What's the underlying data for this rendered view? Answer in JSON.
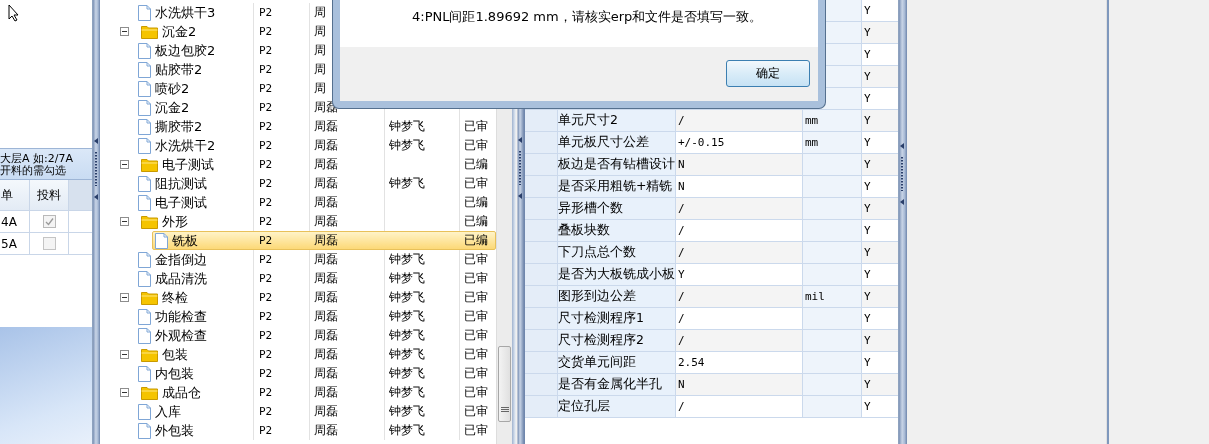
{
  "left_panel": {
    "note_lines": [
      "大层A 如:2/7A",
      "开料的需勾选"
    ],
    "columns": [
      "单",
      "投料"
    ],
    "rows": [
      {
        "order": "4A",
        "checked": true
      },
      {
        "order": "5A",
        "checked": false
      }
    ]
  },
  "tree_grid": {
    "rows": [
      {
        "children": [
          {
            "kind": "file",
            "label": "水洗烘干3",
            "version": "P2",
            "maker": "周",
            "selected": false
          }
        ]
      },
      {
        "kind": "folder",
        "label": "沉金2",
        "expanded": true,
        "version": "P2",
        "maker": "周",
        "selected": false,
        "children": [
          {
            "kind": "file",
            "label": "板边包胶2",
            "version": "P2",
            "maker": "周",
            "selected": false
          },
          {
            "kind": "file",
            "label": "贴胶带2",
            "version": "P2",
            "maker": "周",
            "selected": false
          },
          {
            "kind": "file",
            "label": "喷砂2",
            "version": "P2",
            "maker": "周",
            "selected": false
          },
          {
            "kind": "file",
            "label": "沉金2",
            "version": "P2",
            "maker": "周磊",
            "selected": false
          },
          {
            "kind": "file",
            "label": "撕胶带2",
            "version": "P2",
            "maker": "周磊",
            "checker": "钟梦飞",
            "status": "已审",
            "selected": false
          },
          {
            "kind": "file",
            "label": "水洗烘干2",
            "version": "P2",
            "maker": "周磊",
            "checker": "钟梦飞",
            "status": "已审",
            "selected": false
          }
        ]
      },
      {
        "kind": "folder",
        "label": "电子测试",
        "expanded": true,
        "version": "P2",
        "maker": "周磊",
        "status": "已编",
        "selected": false,
        "children": [
          {
            "kind": "file",
            "label": "阻抗测试",
            "version": "P2",
            "maker": "周磊",
            "checker": "钟梦飞",
            "status": "已审",
            "selected": false
          },
          {
            "kind": "file",
            "label": "电子测试",
            "version": "P2",
            "maker": "周磊",
            "status": "已编",
            "selected": false
          }
        ]
      },
      {
        "kind": "folder",
        "label": "外形",
        "expanded": true,
        "version": "P2",
        "maker": "周磊",
        "status": "已编",
        "selected": false,
        "children": [
          {
            "kind": "file",
            "label": "铣板",
            "version": "P2",
            "maker": "周磊",
            "status": "已编",
            "selected": true
          },
          {
            "kind": "file",
            "label": "金指倒边",
            "version": "P2",
            "maker": "周磊",
            "checker": "钟梦飞",
            "status": "已审",
            "selected": false
          },
          {
            "kind": "file",
            "label": "成品清洗",
            "version": "P2",
            "maker": "周磊",
            "checker": "钟梦飞",
            "status": "已审",
            "selected": false
          }
        ]
      },
      {
        "kind": "folder",
        "label": "终检",
        "expanded": true,
        "version": "P2",
        "maker": "周磊",
        "checker": "钟梦飞",
        "status": "已审",
        "selected": false,
        "children": [
          {
            "kind": "file",
            "label": "功能检查",
            "version": "P2",
            "maker": "周磊",
            "checker": "钟梦飞",
            "status": "已审",
            "selected": false
          },
          {
            "kind": "file",
            "label": "外观检查",
            "version": "P2",
            "maker": "周磊",
            "checker": "钟梦飞",
            "status": "已审",
            "selected": false
          }
        ]
      },
      {
        "kind": "folder",
        "label": "包装",
        "expanded": true,
        "version": "P2",
        "maker": "周磊",
        "checker": "钟梦飞",
        "status": "已审",
        "selected": false,
        "children": [
          {
            "kind": "file",
            "label": "内包装",
            "version": "P2",
            "maker": "周磊",
            "checker": "钟梦飞",
            "status": "已审",
            "selected": false
          }
        ]
      },
      {
        "kind": "folder",
        "label": "成品仓",
        "expanded": true,
        "version": "P2",
        "maker": "周磊",
        "checker": "钟梦飞",
        "status": "已审",
        "selected": false,
        "children": [
          {
            "kind": "file",
            "label": "入库",
            "version": "P2",
            "maker": "周磊",
            "checker": "钟梦飞",
            "status": "已审",
            "selected": false
          },
          {
            "kind": "file",
            "label": "外包装",
            "version": "P2",
            "maker": "周磊",
            "checker": "钟梦飞",
            "status": "已审",
            "selected": false
          }
        ]
      }
    ]
  },
  "param_grid": {
    "rows": [
      {
        "check": "Y"
      },
      {
        "check": "Y"
      },
      {
        "check": "Y"
      },
      {
        "check": "Y"
      },
      {
        "check": "Y"
      },
      {
        "name": "单元尺寸2",
        "value": "/",
        "unit": "mm",
        "check": "Y"
      },
      {
        "name": "单元板尺寸公差",
        "value": "+/-0.15",
        "unit": "mm",
        "check": "Y"
      },
      {
        "name": "板边是否有钻槽设计",
        "value": "N",
        "check": "Y"
      },
      {
        "name": "是否采用粗铣+精铣",
        "value": "N",
        "check": "Y"
      },
      {
        "name": "异形槽个数",
        "value": "/",
        "check": "Y"
      },
      {
        "name": "叠板块数",
        "value": "/",
        "check": "Y"
      },
      {
        "name": "下刀点总个数",
        "value": "/",
        "check": "Y"
      },
      {
        "name": "是否为大板铣成小板",
        "value": "Y",
        "check": "Y"
      },
      {
        "name": "图形到边公差",
        "value": "/",
        "unit": "mil",
        "check": "Y"
      },
      {
        "name": "尺寸检测程序1",
        "value": "/",
        "check": "Y"
      },
      {
        "name": "尺寸检测程序2",
        "value": "/",
        "check": "Y"
      },
      {
        "name": "交货单元间距",
        "value": "2.54",
        "check": "Y"
      },
      {
        "name": "是否有金属化半孔",
        "value": "N",
        "check": "Y"
      },
      {
        "name": "定位孔层",
        "value": "/",
        "check": "Y"
      }
    ]
  },
  "dialog": {
    "message": "4:PNL间距1.89692 mm，请核实erp和文件是否填写一致。",
    "button": "确定"
  }
}
